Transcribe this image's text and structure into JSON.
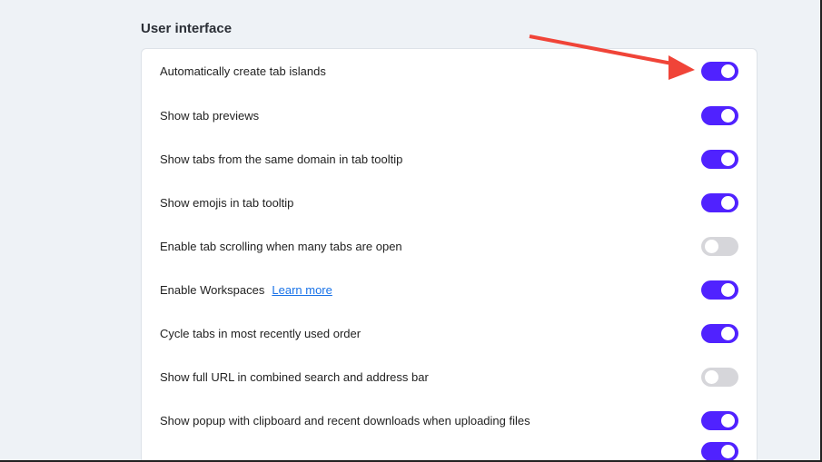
{
  "section_title": "User interface",
  "settings": [
    {
      "label": "Automatically create tab islands",
      "on": true
    },
    {
      "label": "Show tab previews",
      "on": true
    },
    {
      "label": "Show tabs from the same domain in tab tooltip",
      "on": true
    },
    {
      "label": "Show emojis in tab tooltip",
      "on": true
    },
    {
      "label": "Enable tab scrolling when many tabs are open",
      "on": false
    },
    {
      "label": "Enable Workspaces",
      "link": "Learn more",
      "on": true
    },
    {
      "label": "Cycle tabs in most recently used order",
      "on": true
    },
    {
      "label": "Show full URL in combined search and address bar",
      "on": false
    },
    {
      "label": "Show popup with clipboard and recent downloads when uploading files",
      "on": true
    },
    {
      "label": "",
      "on": true
    }
  ],
  "colors": {
    "toggle_on": "#5022ff",
    "toggle_off": "#d6d6da",
    "arrow": "#f04438"
  }
}
